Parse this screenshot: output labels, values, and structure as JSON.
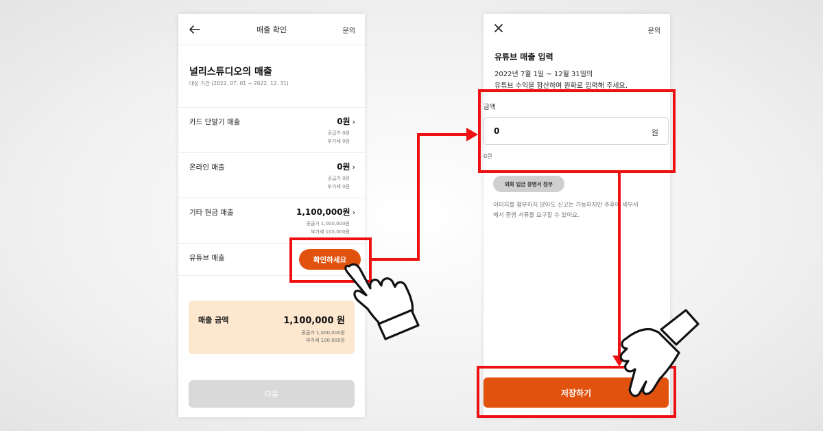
{
  "left_screen": {
    "header": {
      "title": "매출 확인",
      "link": "문의"
    },
    "business_name": "널리스튜디오의 매출",
    "period": "대상 기간 (2022. 07. 01 ~ 2022. 12. 31)",
    "rows": [
      {
        "label": "카드 단말기 매출",
        "amount": "0원",
        "supply": "공급가 0원",
        "vat": "부가세 0원"
      },
      {
        "label": "온라인 매출",
        "amount": "0원",
        "supply": "공급가 0원",
        "vat": "부가세 0원"
      },
      {
        "label": "기타 현금 매출",
        "amount": "1,100,000원",
        "supply": "공급가 1,000,000원",
        "vat": "부가세 100,000원"
      },
      {
        "label": "유튜브 매출",
        "button": "확인하세요"
      }
    ],
    "summary": {
      "label": "매출 금액",
      "amount": "1,100,000 원",
      "supply": "공급가 1,000,000원",
      "vat": "부가세 100,000원"
    },
    "next_button": "다음"
  },
  "right_screen": {
    "header": {
      "link": "문의"
    },
    "title": "유튜브 매출 입력",
    "description_line1": "2022년 7월 1일 ~ 12월 31일의",
    "description_line2": "유튜브 수익을 합산하여 원화로 입력해 주세요.",
    "field_label": "금액",
    "field_value": "0",
    "field_unit": "원",
    "field_helper": "0원",
    "attach_button": "외화 입금 증명서 첨부",
    "notice_line1": "이미지를 첨부하지 않아도 신고는 가능하지만 추후에 세무서",
    "notice_line2": "에서 증명 서류를 요구할 수 있어요.",
    "save_button": "저장하기"
  },
  "colors": {
    "accent": "#e2520f",
    "highlight": "#ee1111",
    "summary_bg": "#fde7cf",
    "disabled": "#d9d9d9"
  }
}
